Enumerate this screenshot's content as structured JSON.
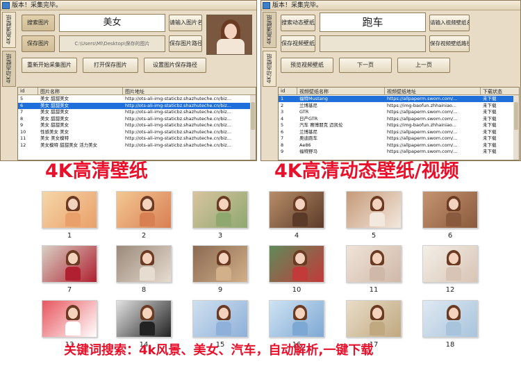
{
  "left_window": {
    "title": "版本！采集完毕。",
    "tabs": [
      "4K高清壁纸",
      "4K动态壁纸"
    ],
    "search_button": "搜索图片",
    "keyword": "美女",
    "input_name_button": "请输入图片名",
    "save_button": "保存图片",
    "save_path": "C:\\Users\\Ml\\Desktop\\保存的图片",
    "save_path_button": "保存图片路径",
    "restart_button": "重新开始采集图片",
    "open_folder_button": "打开保存图片",
    "set_path_button": "设置图片保存路径",
    "grid": {
      "columns": [
        "id",
        "图片名称",
        "图片地址"
      ],
      "rows": [
        [
          "5",
          "美女 甜甜美女",
          "http://ots-ali-img-staticbz.shazhuteche.cn/biz..."
        ],
        [
          "6",
          "美女 甜甜美女",
          "http://ots-ali-img-staticbz.shazhuteche.cn/biz..."
        ],
        [
          "7",
          "美女 甜甜美女",
          "http://ots-ali-img-staticbz.shazhuteche.cn/biz..."
        ],
        [
          "8",
          "美女 甜甜美女",
          "http://ots-ali-img-staticbz.shazhuteche.cn/biz..."
        ],
        [
          "9",
          "美女 甜甜美女",
          "http://ots-ali-img-staticbz.shazhuteche.cn/biz..."
        ],
        [
          "10",
          "性感美女 美女",
          "http://ots-ali-img-staticbz.shazhuteche.cn/biz..."
        ],
        [
          "11",
          "美女 美女模特",
          "http://ots-ali-img-staticbz.shazhuteche.cn/biz..."
        ],
        [
          "12",
          "美女模特 甜甜美女 活力美女",
          "http://ots-ali-img-staticbz.shazhuteche.cn/biz..."
        ]
      ],
      "selected_row": 1
    }
  },
  "right_window": {
    "title": "版本！采集完毕。",
    "tabs": [
      "4K高清壁纸",
      "4K动态壁纸"
    ],
    "search_button": "搜索动态壁纸",
    "keyword": "跑车",
    "input_name_button": "请输入视频壁纸名",
    "save_button": "保存视频壁纸",
    "save_path_button": "保存视频壁纸路径",
    "preview_button": "预览视频壁纸",
    "next_button": "下一页",
    "prev_button": "上一页",
    "grid": {
      "columns": [
        "id",
        "视频壁纸名称",
        "视频壁纸地址",
        "下载状态"
      ],
      "rows": [
        [
          "1",
          "福特Mustang",
          "https://allpaperm.swom.com/...",
          "未下载"
        ],
        [
          "2",
          "兰博基尼",
          "https://img-baofun.zhhainiao...",
          "未下载"
        ],
        [
          "3",
          "GTR",
          "https://allpaperm.swom.com/...",
          "未下载"
        ],
        [
          "4",
          "日产GTR",
          "https://allpaperm.swom.com/...",
          "未下载"
        ],
        [
          "5",
          "汽车 赛博朋克 迈凯伦",
          "https://img-baofun.zhhainiao...",
          "未下载"
        ],
        [
          "6",
          "兰博基尼",
          "https://allpaperm.swom.com/...",
          "未下载"
        ],
        [
          "7",
          "奥迪跑车",
          "https://allpaperm.swom.com/...",
          "未下载"
        ],
        [
          "8",
          "Ae86",
          "https://allpaperm.swom.com/...",
          "未下载"
        ],
        [
          "9",
          "福特野马",
          "https://allpaperm.swom.com/...",
          "未下载"
        ]
      ],
      "selected_row": 0
    }
  },
  "banners": {
    "left": "4K高清壁纸",
    "right": "4K高清动态壁纸/视频",
    "bottom": "关键词搜索：4k风景、美女、汽车，自动解析,一键下载"
  },
  "gallery": {
    "tiles": [
      {
        "num": "1",
        "bg": "#f6d6a8",
        "accent": "#e9a06a"
      },
      {
        "num": "2",
        "bg": "#f3c892",
        "accent": "#d97f54"
      },
      {
        "num": "3",
        "bg": "#d9c4a0",
        "accent": "#8fa870"
      },
      {
        "num": "4",
        "bg": "#b78e6a",
        "accent": "#5c3a28"
      },
      {
        "num": "5",
        "bg": "#c69a78",
        "accent": "#f3e8de"
      },
      {
        "num": "6",
        "bg": "#c59470",
        "accent": "#8a5a3e"
      },
      {
        "num": "7",
        "bg": "#d8d0c4",
        "accent": "#b02030"
      },
      {
        "num": "8",
        "bg": "#9b8a7a",
        "accent": "#e6dcd0"
      },
      {
        "num": "9",
        "bg": "#8a6a52",
        "accent": "#d2b08a"
      },
      {
        "num": "10",
        "bg": "#5f8b5a",
        "accent": "#c23a3a"
      },
      {
        "num": "11",
        "bg": "#efe4d8",
        "accent": "#d0b8a8"
      },
      {
        "num": "12",
        "bg": "#f4efe8",
        "accent": "#d8c4b4"
      },
      {
        "num": "13",
        "bg": "#e8565e",
        "accent": "#ffffff"
      },
      {
        "num": "14",
        "bg": "#e2e2e2",
        "accent": "#222222"
      },
      {
        "num": "15",
        "bg": "#cfe0f0",
        "accent": "#8fb0d8"
      },
      {
        "num": "16",
        "bg": "#cfe3f3",
        "accent": "#7ea8d4"
      },
      {
        "num": "17",
        "bg": "#e9ddc8",
        "accent": "#c0a880"
      },
      {
        "num": "18",
        "bg": "#dfe9f2",
        "accent": "#a8c4dc"
      }
    ]
  }
}
